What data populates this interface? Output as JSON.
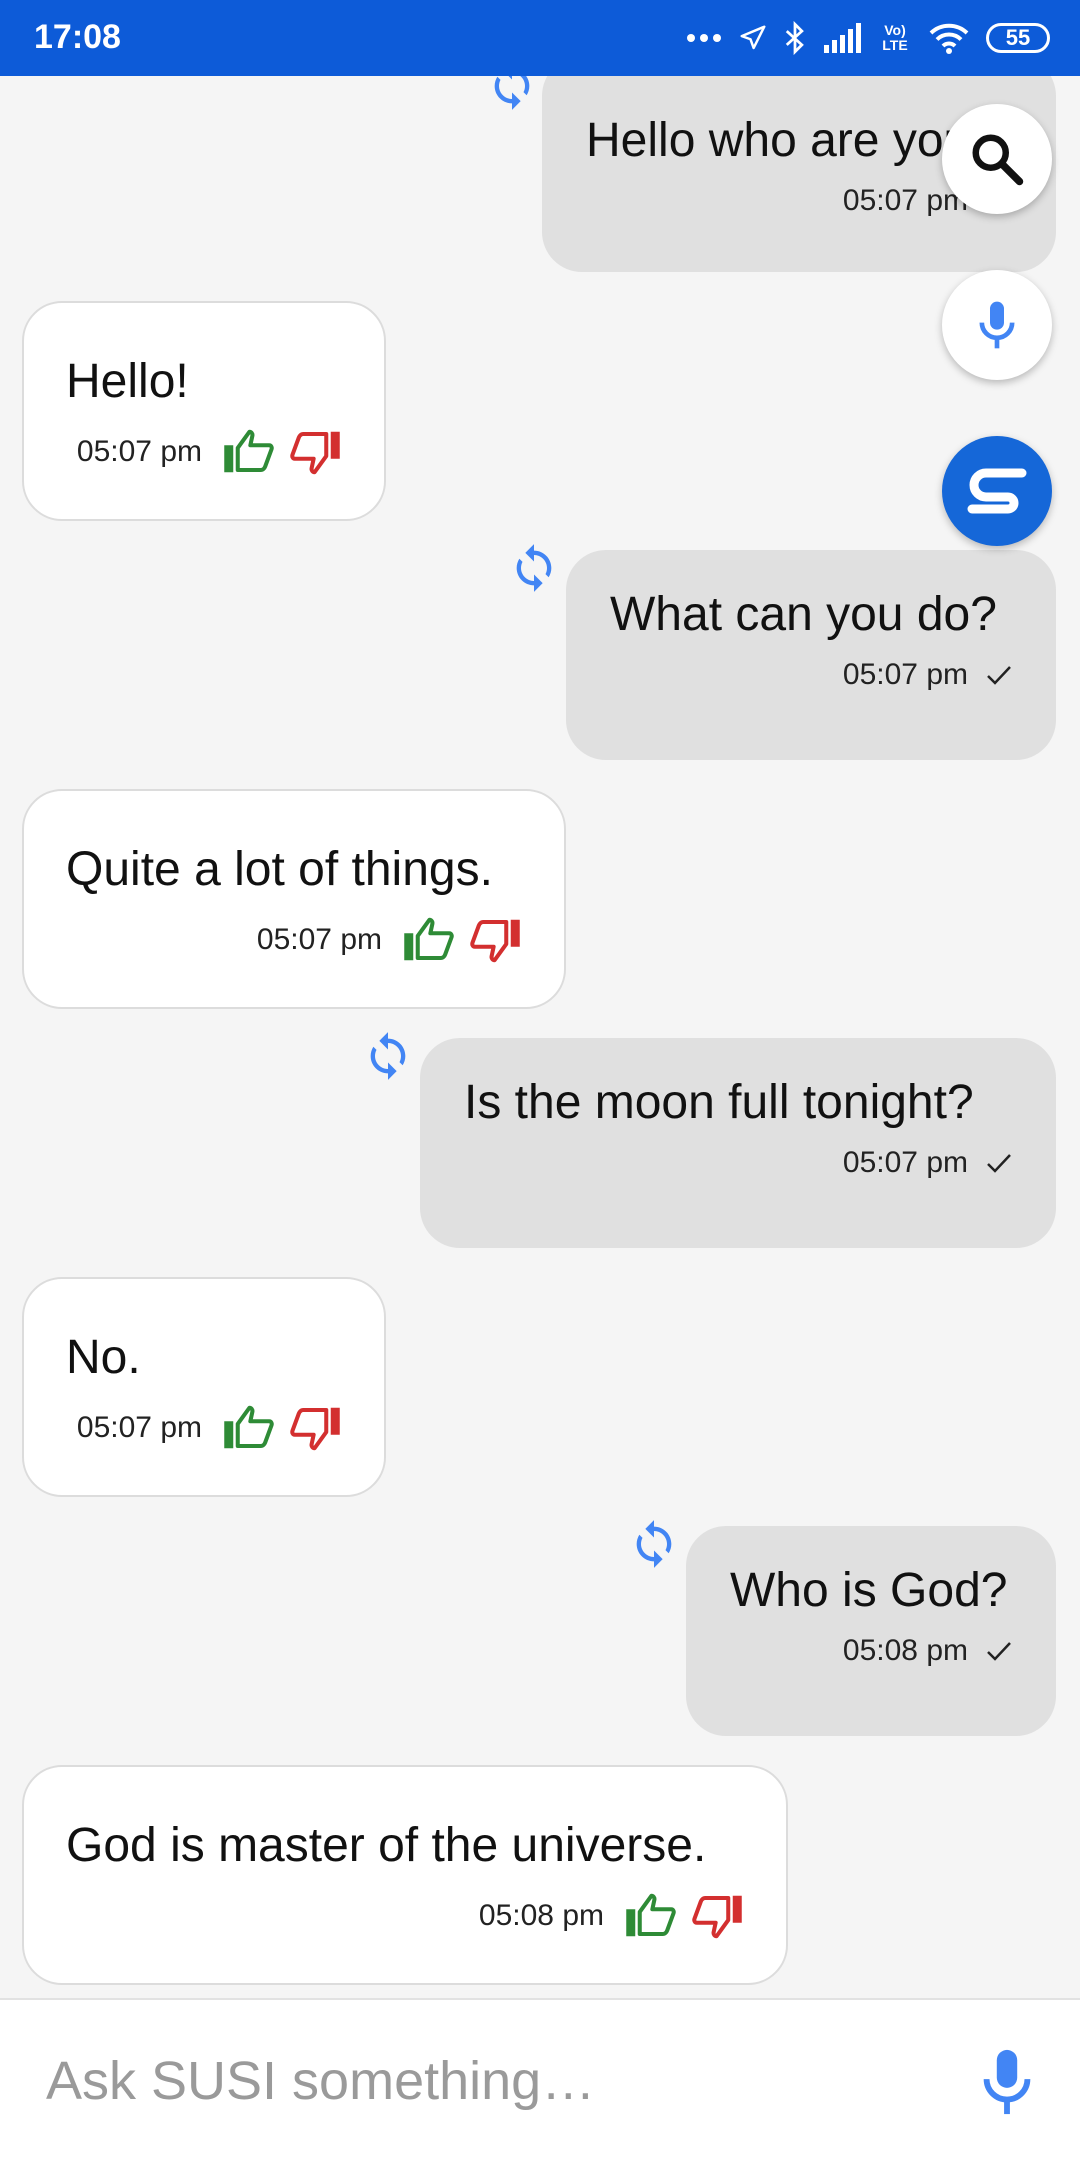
{
  "status_bar": {
    "time": "17:08",
    "battery": "55",
    "network_label": "Vo) LTE",
    "icons": [
      "more-dots-icon",
      "location-arrow-icon",
      "bluetooth-icon",
      "signal-icon",
      "volte-icon",
      "wifi-icon",
      "battery-icon"
    ]
  },
  "messages": [
    {
      "from": "user",
      "text": "Hello who are you?",
      "time": "05:07 pm"
    },
    {
      "from": "bot",
      "text": "Hello!",
      "time": "05:07 pm"
    },
    {
      "from": "user",
      "text": "What can you do?",
      "time": "05:07 pm"
    },
    {
      "from": "bot",
      "text": "Quite a lot of things.",
      "time": "05:07 pm"
    },
    {
      "from": "user",
      "text": "Is the moon full tonight?",
      "time": "05:07 pm"
    },
    {
      "from": "bot",
      "text": "No.",
      "time": "05:07 pm"
    },
    {
      "from": "user",
      "text": "Who is God?",
      "time": "05:08 pm"
    },
    {
      "from": "bot",
      "text": "God is master of the universe.",
      "time": "05:08 pm"
    }
  ],
  "fabs": [
    "search-icon",
    "mic-icon",
    "susi-logo-icon"
  ],
  "input": {
    "placeholder": "Ask SUSI something…",
    "value": ""
  },
  "colors": {
    "status_bar": "#0d5bd8",
    "accent_blue": "#4285f4",
    "thumb_up": "#2e8b36",
    "thumb_down": "#d32f2f",
    "user_bubble": "#e0e0e0",
    "bot_bubble": "#ffffff"
  }
}
